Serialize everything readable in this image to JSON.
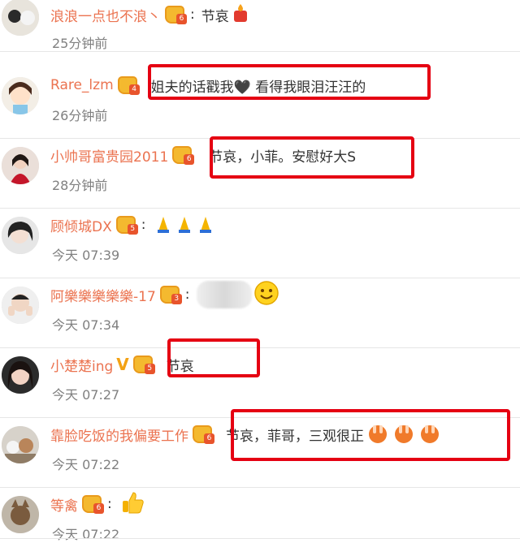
{
  "comments": [
    {
      "user": "浪浪一点也不浪丶",
      "level": "6",
      "text": "节哀",
      "time": "25分钟前"
    },
    {
      "user": "Rare_lzm",
      "level": "4",
      "text": "姐夫的话戳我🖤 看得我眼泪汪汪的",
      "time": "26分钟前"
    },
    {
      "user": "小帅哥富贵园2011",
      "level": "6",
      "text": "节哀，小菲。安慰好大S",
      "time": "28分钟前"
    },
    {
      "user": "顾倾城DX",
      "level": "5",
      "text": "",
      "time": "今天 07:39"
    },
    {
      "user": "阿樂樂樂樂樂-17",
      "level": "3",
      "text": "",
      "time": "今天 07:34"
    },
    {
      "user": "小楚楚ing",
      "level": "5",
      "text": "节哀",
      "time": "今天 07:27"
    },
    {
      "user": "靠脸吃饭的我偏要工作",
      "level": "6",
      "text": "节哀，菲哥，三观很正",
      "time": "今天 07:22"
    },
    {
      "user": "等禽",
      "level": "6",
      "text": "",
      "time": "今天 07:22"
    }
  ],
  "icons": {
    "verified_v": "V",
    "crown_color": "#f4b92f",
    "highlight_color": "#e50012",
    "username_color": "#eb7350"
  }
}
